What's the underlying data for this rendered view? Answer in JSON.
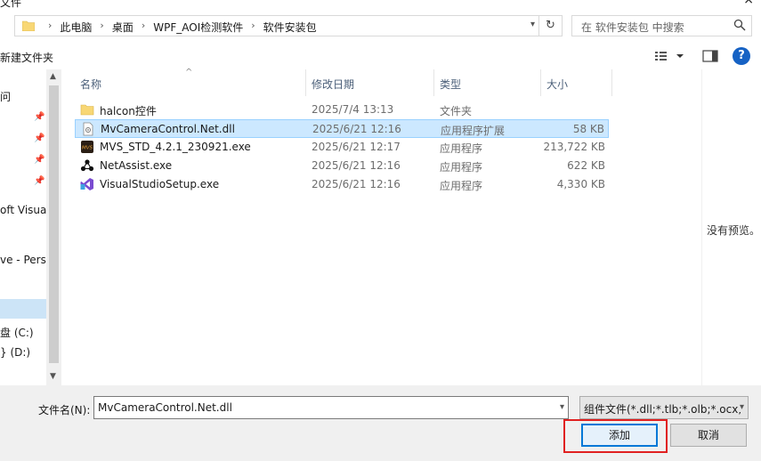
{
  "window": {
    "title": "文件",
    "close_glyph": "×"
  },
  "address": {
    "crumbs": [
      "此电脑",
      "桌面",
      "WPF_AOI检测软件",
      "软件安装包"
    ],
    "separator": "›",
    "search_placeholder": "在 软件安装包 中搜索"
  },
  "toolbar": {
    "new_folder": "新建文件夹",
    "help": "?"
  },
  "nav": {
    "items": [
      {
        "label": "问",
        "pinned": false
      },
      {
        "label": "",
        "pinned": true
      },
      {
        "label": "",
        "pinned": true
      },
      {
        "label": "",
        "pinned": true
      },
      {
        "label": "",
        "pinned": true
      },
      {
        "label": "oft Visual",
        "pinned": false
      },
      {
        "label": "ve - Perso",
        "pinned": false
      },
      {
        "label": "盘 (C:)",
        "pinned": false
      },
      {
        "label": "} (D:)",
        "pinned": false
      }
    ]
  },
  "columns": {
    "name": "名称",
    "date": "修改日期",
    "type": "类型",
    "size": "大小"
  },
  "files": [
    {
      "name": "halcon控件",
      "date": "2025/7/4 13:13",
      "type": "文件夹",
      "size": "",
      "icon": "folder-icon",
      "selected": false
    },
    {
      "name": "MvCameraControl.Net.dll",
      "date": "2025/6/21 12:16",
      "type": "应用程序扩展",
      "size": "58 KB",
      "icon": "dll-icon",
      "selected": true
    },
    {
      "name": "MVS_STD_4.2.1_230921.exe",
      "date": "2025/6/21 12:17",
      "type": "应用程序",
      "size": "213,722 KB",
      "icon": "mvs-icon",
      "selected": false
    },
    {
      "name": "NetAssist.exe",
      "date": "2025/6/21 12:16",
      "type": "应用程序",
      "size": "622 KB",
      "icon": "netassist-icon",
      "selected": false
    },
    {
      "name": "VisualStudioSetup.exe",
      "date": "2025/6/21 12:16",
      "type": "应用程序",
      "size": "4,330 KB",
      "icon": "visual-studio-icon",
      "selected": false
    }
  ],
  "preview": {
    "message": "没有预览。"
  },
  "footer": {
    "filename_label": "文件名(N):",
    "filename_value": "MvCameraControl.Net.dll",
    "filter_value": "组件文件(*.dll;*.tlb;*.olb;*.ocx;",
    "add_button": "添加",
    "cancel_button": "取消"
  },
  "colors": {
    "accent": "#0078d7",
    "selection": "#cce8ff",
    "highlight_border": "#e02020"
  }
}
